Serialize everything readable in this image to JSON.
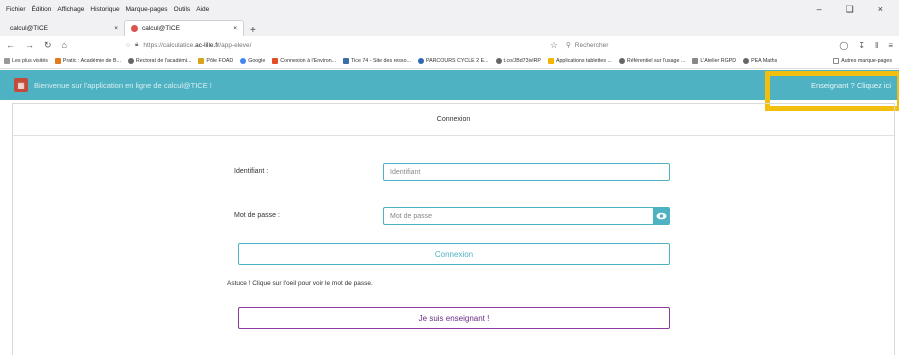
{
  "browser": {
    "menu": [
      "Fichier",
      "Édition",
      "Affichage",
      "Historique",
      "Marque-pages",
      "Outils",
      "Aide"
    ],
    "tabs": [
      {
        "label": "calcul@TICE"
      },
      {
        "label": "calcul@TICE"
      }
    ],
    "url_prefix": "https://calculatice.",
    "url_domain": "ac-lille.fr",
    "url_path": "/app-eleve/",
    "search_placeholder": "Rechercher",
    "bookmarks": [
      "Les plus visités",
      "Pratic : Académie de B...",
      "Rectorat de l'académi...",
      "Pôle FOAD",
      "Google",
      "Connexion à l'Environ...",
      "Tice 74 - Site des resso...",
      "PARCOURS CYCLE 2 E...",
      "t.co/JBd73ivlRP",
      "Applications tablettes ...",
      "Référentiel sur l'usage ...",
      "L'Atelier RGPD",
      "PEA Maths"
    ],
    "bookmarks_other": "Autres marque-pages"
  },
  "app": {
    "welcome": "Bienvenue sur l'application en ligne de calcul@TICE !",
    "teacher_link": "Enseignant ? Cliquez ici",
    "panel_title": "Connexion",
    "id_label": "Identifiant :",
    "id_placeholder": "Identifiant",
    "pw_label": "Mot de passe :",
    "pw_placeholder": "Mot de passe",
    "login_button": "Connexion",
    "tip": "Astuce ! Clique sur l'oeil pour voir le mot de passe.",
    "teacher_button": "Je suis enseignant !"
  },
  "colors": {
    "accent": "#4fb2c2",
    "highlight": "#f3bf0f",
    "teacher": "#8b3aa0"
  }
}
